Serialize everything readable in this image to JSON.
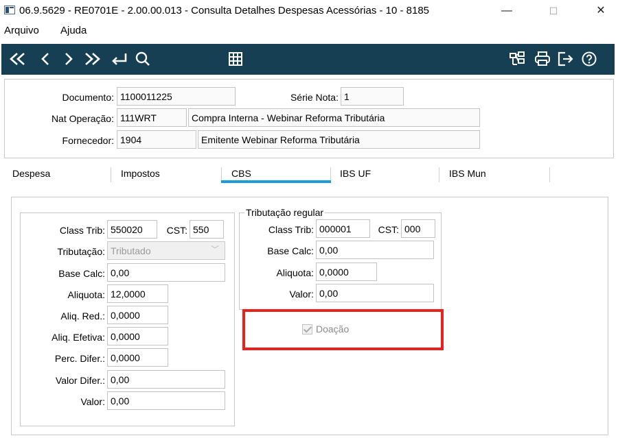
{
  "window": {
    "title": "06.9.5629 - RE0701E - 2.00.00.013 - Consulta Detalhes Despesas Acessórias - 10 - 8185",
    "minimize": "—",
    "maximize": "☐",
    "close": "✕"
  },
  "menu": {
    "items": [
      "Arquivo",
      "Ajuda"
    ]
  },
  "toolbar": {
    "toolbar_bg": "#163f53",
    "left_icons": [
      "first-icon",
      "previous-icon",
      "next-icon",
      "last-icon",
      "goto-icon",
      "search-icon"
    ],
    "center_icon": "grid-icon",
    "right_icons": [
      "hierarchy-icon",
      "print-icon",
      "exit-icon",
      "help-icon"
    ]
  },
  "header": {
    "documento_label": "Documento:",
    "documento_value": "1100011225",
    "serie_label": "Série Nota:",
    "serie_value": "1",
    "natop_label": "Nat Operação:",
    "natop_code": "111WRT",
    "natop_desc": "Compra Interna - Webinar Reforma Tributária",
    "fornecedor_label": "Fornecedor:",
    "fornecedor_code": "1904",
    "fornecedor_desc": "Emitente Webinar Reforma Tributária"
  },
  "tabs": {
    "items": [
      "Despesa",
      "Impostos",
      "CBS",
      "IBS UF",
      "IBS Mun"
    ],
    "active": "CBS",
    "accent": "#1a9bdc"
  },
  "cbs": {
    "class_trib_label": "Class Trib:",
    "class_trib_value": "550020",
    "cst_label": "CST:",
    "cst_value": "550",
    "tributacao_label": "Tributação:",
    "tributacao_value": "Tributado",
    "base_calc_label": "Base Calc:",
    "base_calc_value": "0,00",
    "aliquota_label": "Aliquota:",
    "aliquota_value": "12,0000",
    "aliq_red_label": "Aliq. Red.:",
    "aliq_red_value": "0,0000",
    "aliq_efetiva_label": "Aliq. Efetiva:",
    "aliq_efetiva_value": "0,0000",
    "perc_difer_label": "Perc. Difer.:",
    "perc_difer_value": "0,0000",
    "valor_difer_label": "Valor Difer.:",
    "valor_difer_value": "0,00",
    "valor_label": "Valor:",
    "valor_value": "0,00"
  },
  "regular": {
    "group_title": "Tributação regular",
    "class_trib_label": "Class Trib:",
    "class_trib_value": "000001",
    "cst_label": "CST:",
    "cst_value": "000",
    "base_calc_label": "Base Calc:",
    "base_calc_value": "0,00",
    "aliquota_label": "Aliquota:",
    "aliquota_value": "0,0000",
    "valor_label": "Valor:",
    "valor_value": "0,00"
  },
  "doacao": {
    "label": "Doação",
    "checked": true,
    "highlight_color": "#e8201e"
  }
}
